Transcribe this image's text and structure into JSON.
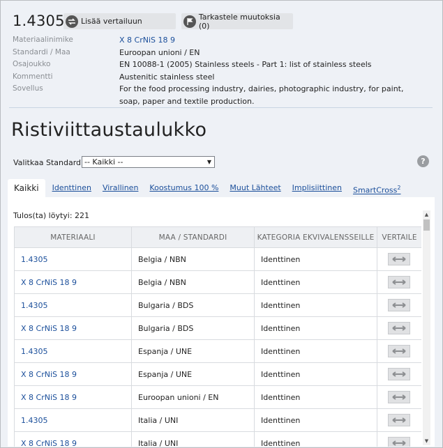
{
  "header": {
    "code": "1.4305",
    "compare_button": "Lisää vertailuun",
    "changes_button": "Tarkastele muutoksia (0)"
  },
  "meta": [
    {
      "label": "Materiaalinimike",
      "value": "X 8 CrNiS 18 9"
    },
    {
      "label": "Standardi / Maa",
      "value": "Euroopan unioni / EN"
    },
    {
      "label": "Osajoukko",
      "value": "EN 10088-1 (2005) Stainless steels - Part 1: list of stainless steels"
    },
    {
      "label": "Kommentti",
      "value": "Austenitic stainless steel"
    },
    {
      "label": "Sovellus",
      "value": "For the food processing industry, dairies, photographic industry, for paint, soap, paper and textile production."
    }
  ],
  "page_title": "Ristiviittaustaulukko",
  "standard_select": {
    "label": "Valitkaa Standardi:",
    "selected": "-- Kaikki --"
  },
  "help": "?",
  "tabs": [
    {
      "label": "Kaikki",
      "sup": ""
    },
    {
      "label": "Identtinen",
      "sup": ""
    },
    {
      "label": "Virallinen",
      "sup": ""
    },
    {
      "label": "Koostumus 100 %",
      "sup": ""
    },
    {
      "label": "Muut Lähteet",
      "sup": ""
    },
    {
      "label": "Implisiittinen",
      "sup": ""
    },
    {
      "label": "SmartCross",
      "sup": "2"
    }
  ],
  "results": {
    "count_text": "Tulos(ta) löytyi: 221",
    "columns": [
      "MATERIAALI",
      "MAA / STANDARDI",
      "KATEGORIA EKVIVALENSSEILLE",
      "VERTAILE"
    ],
    "rows": [
      {
        "material": "1.4305",
        "standard": "Belgia / NBN",
        "category": "Identtinen"
      },
      {
        "material": "X 8 CrNiS 18 9",
        "standard": "Belgia / NBN",
        "category": "Identtinen"
      },
      {
        "material": "1.4305",
        "standard": "Bulgaria / BDS",
        "category": "Identtinen"
      },
      {
        "material": "X 8 CrNiS 18 9",
        "standard": "Bulgaria / BDS",
        "category": "Identtinen"
      },
      {
        "material": "1.4305",
        "standard": "Espanja / UNE",
        "category": "Identtinen"
      },
      {
        "material": "X 8 CrNiS 18 9",
        "standard": "Espanja / UNE",
        "category": "Identtinen"
      },
      {
        "material": "X 8 CrNiS 18 9",
        "standard": "Euroopan unioni / EN",
        "category": "Identtinen"
      },
      {
        "material": "1.4305",
        "standard": "Italia / UNI",
        "category": "Identtinen"
      },
      {
        "material": "X 8 CrNiS 18 9",
        "standard": "Italia / UNI",
        "category": "Identtinen"
      }
    ]
  },
  "colors": {
    "link": "#1a4e9a",
    "page_bg": "#eef1f6"
  }
}
